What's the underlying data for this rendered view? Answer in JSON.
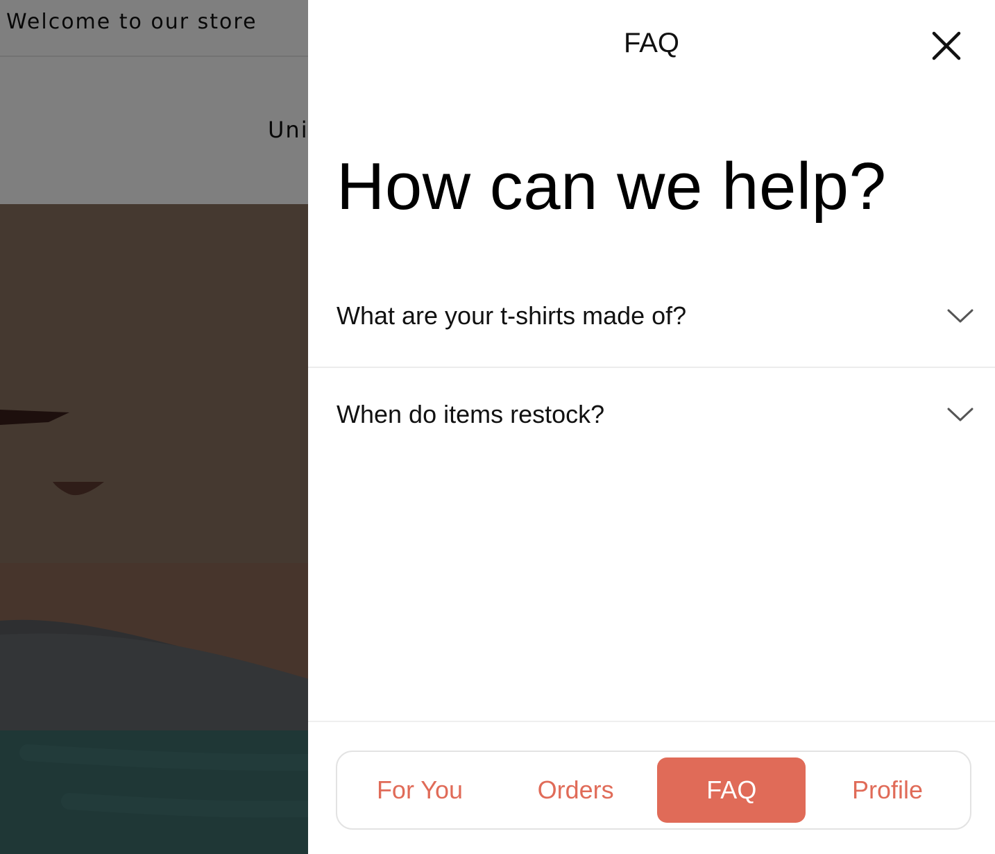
{
  "store": {
    "announcement": "Welcome to our store",
    "header_country_partial": "Unit"
  },
  "faq_drawer": {
    "title": "FAQ",
    "close_icon": "close-icon",
    "heading": "How can we help?",
    "questions": [
      {
        "question": "What are your t-shirts made of?",
        "icon": "chevron-down-icon"
      },
      {
        "question": "When do items restock?",
        "icon": "chevron-down-icon"
      }
    ],
    "tabs": [
      {
        "label": "For You",
        "active": false
      },
      {
        "label": "Orders",
        "active": false
      },
      {
        "label": "FAQ",
        "active": true
      },
      {
        "label": "Profile",
        "active": false
      }
    ]
  },
  "colors": {
    "accent": "#e06b58",
    "overlay": "rgba(0,0,0,0.5)",
    "divider": "#ececec"
  }
}
